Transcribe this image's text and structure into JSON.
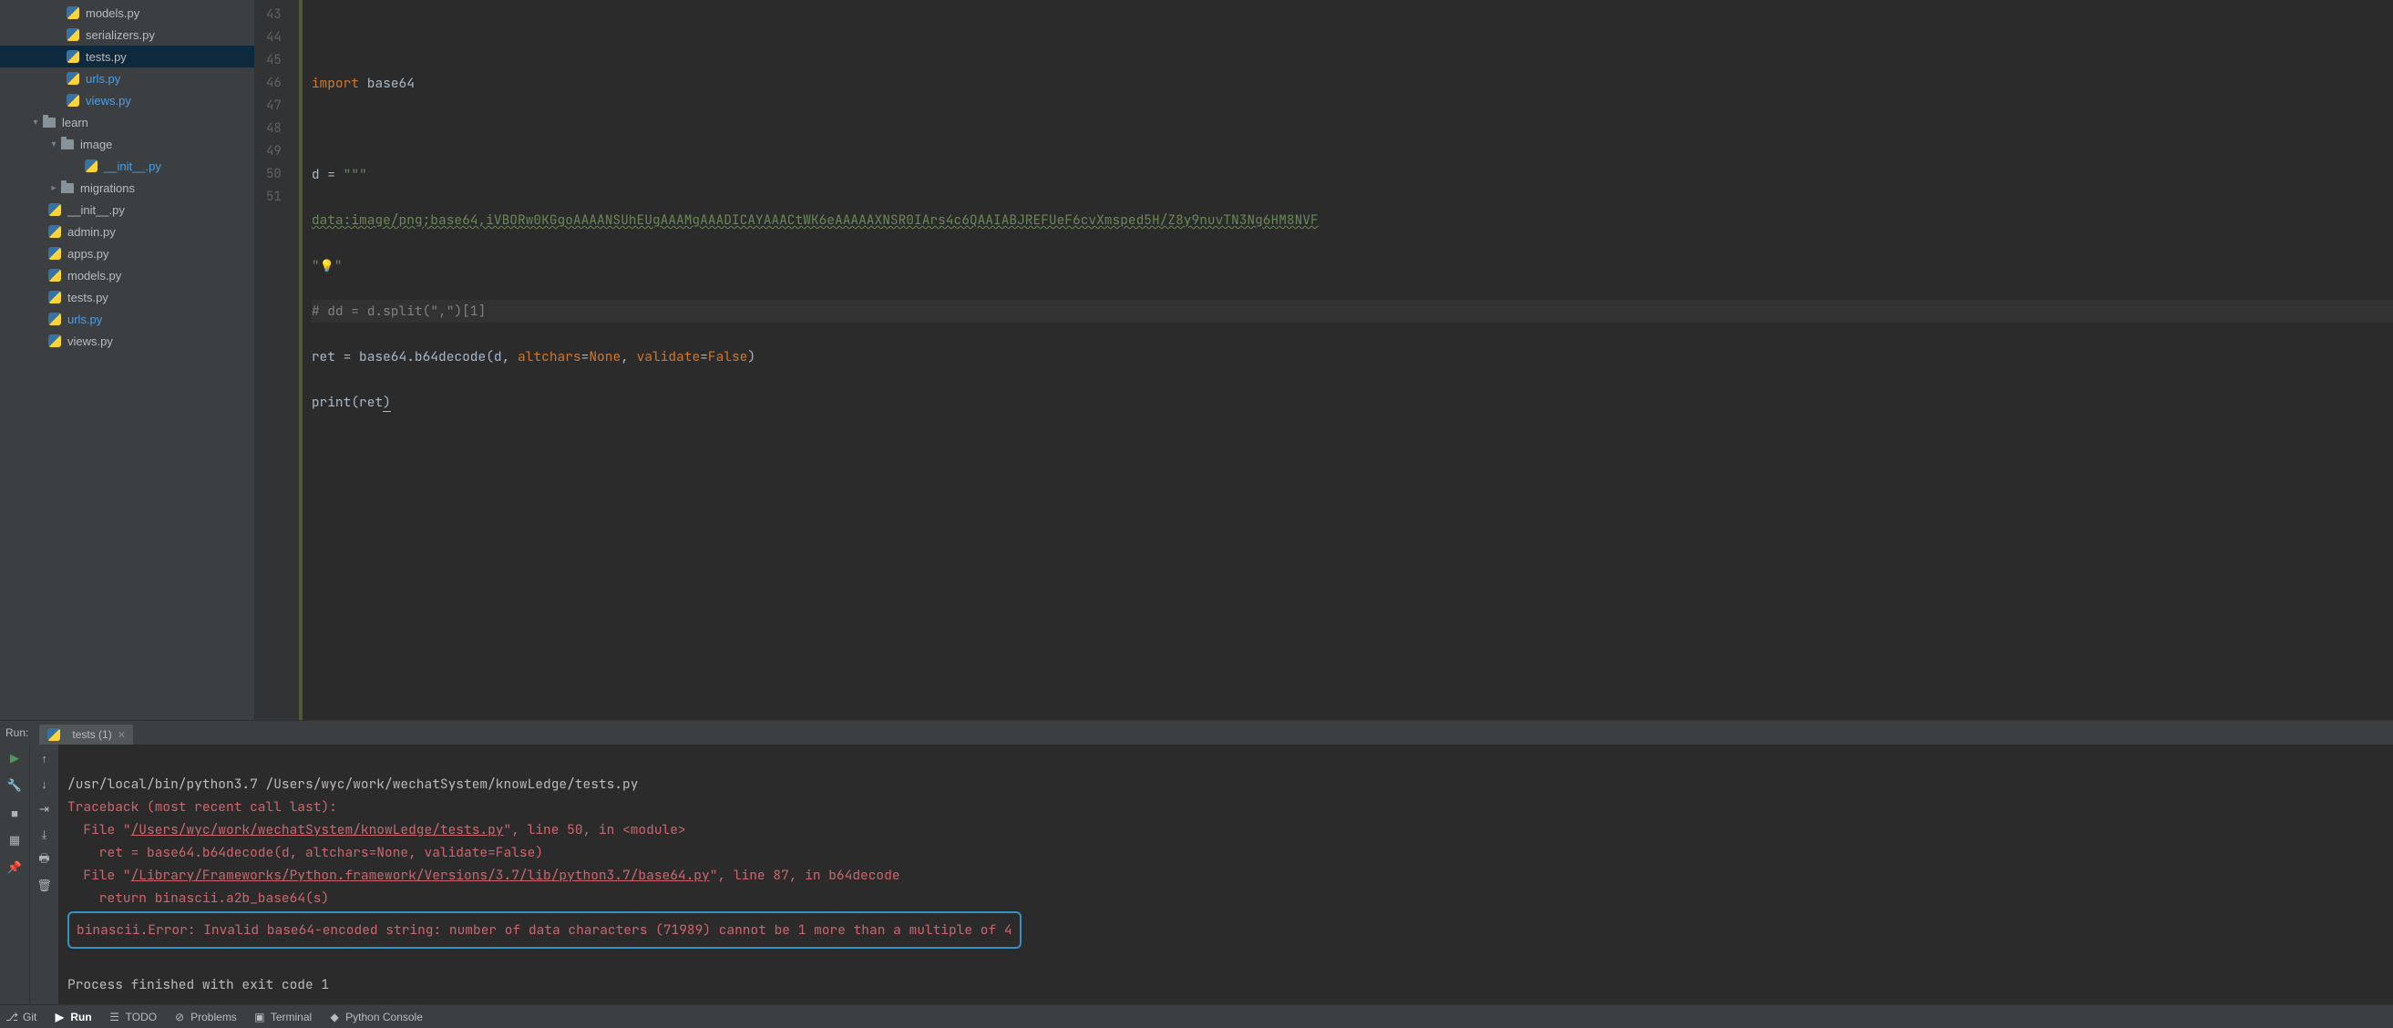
{
  "sidebar": {
    "items": [
      {
        "label": "models.py",
        "type": "py",
        "indent": 64,
        "hl": false
      },
      {
        "label": "serializers.py",
        "type": "py",
        "indent": 64,
        "hl": false
      },
      {
        "label": "tests.py",
        "type": "py",
        "indent": 64,
        "hl": false,
        "selected": true
      },
      {
        "label": "urls.py",
        "type": "py",
        "indent": 64,
        "hl": true
      },
      {
        "label": "views.py",
        "type": "py",
        "indent": 64,
        "hl": true
      },
      {
        "label": "learn",
        "type": "folder",
        "indent": 24,
        "chevron": "down"
      },
      {
        "label": "image",
        "type": "folder",
        "indent": 44,
        "chevron": "down"
      },
      {
        "label": "__init__.py",
        "type": "py",
        "indent": 84,
        "hl": true
      },
      {
        "label": "migrations",
        "type": "folder",
        "indent": 44,
        "chevron": "right"
      },
      {
        "label": "__init__.py",
        "type": "py",
        "indent": 44,
        "hl": false
      },
      {
        "label": "admin.py",
        "type": "py",
        "indent": 44,
        "hl": false
      },
      {
        "label": "apps.py",
        "type": "py",
        "indent": 44,
        "hl": false
      },
      {
        "label": "models.py",
        "type": "py",
        "indent": 44,
        "hl": false
      },
      {
        "label": "tests.py",
        "type": "py",
        "indent": 44,
        "hl": false
      },
      {
        "label": "urls.py",
        "type": "py",
        "indent": 44,
        "hl": true
      },
      {
        "label": "views.py",
        "type": "py",
        "indent": 44,
        "hl": false
      }
    ]
  },
  "editor": {
    "gutter_start": 43,
    "gutter_end": 51,
    "lines": {
      "l43": "",
      "l44_kw": "import",
      "l44_mod": " base64",
      "l45": "",
      "l46_a": "d = ",
      "l46_b": "\"\"\"",
      "l47": "data:image/png;base64,iVBORw0KGgoAAAANSUhEUgAAAMgAAADICAYAAACtWK6eAAAAAXNSR0IArs4c6QAAIABJREFUeF6cvXmsped5H/Z8y9nuvTN3Ng6HM8NVF",
      "l48_a": "\"",
      "l48_b": "\"",
      "l49": "# dd = d.split(\",\")[1]",
      "l50_a": "ret = base64.b64decode(d",
      "l50_b": ", ",
      "l50_c": "altchars",
      "l50_d": "=",
      "l50_e": "None",
      "l50_f": ", ",
      "l50_g": "validate",
      "l50_h": "=",
      "l50_i": "False",
      "l50_j": ")",
      "l51_a": "print",
      "l51_b": "(ret",
      "l51_c": ")"
    }
  },
  "run": {
    "label": "Run:",
    "tab_label": "tests (1)",
    "console": {
      "cmd": "/usr/local/bin/python3.7 /Users/wyc/work/wechatSystem/knowLedge/tests.py",
      "tb_head": "Traceback (most recent call last):",
      "f1_pre": "  File \"",
      "f1_link": "/Users/wyc/work/wechatSystem/knowLedge/tests.py",
      "f1_post": "\", line 50, in <module>",
      "f1_code": "    ret = base64.b64decode(d, altchars=None, validate=False)",
      "f2_pre": "  File \"",
      "f2_link": "/Library/Frameworks/Python.framework/Versions/3.7/lib/python3.7/base64.py",
      "f2_post": "\", line 87, in b64decode",
      "f2_code": "    return binascii.a2b_base64(s)",
      "error": "binascii.Error: Invalid base64-encoded string: number of data characters (71989) cannot be 1 more than a multiple of 4",
      "exit": "Process finished with exit code 1"
    }
  },
  "bottom": {
    "git": "Git",
    "run": "Run",
    "todo": "TODO",
    "problems": "Problems",
    "terminal": "Terminal",
    "pyconsole": "Python Console"
  }
}
